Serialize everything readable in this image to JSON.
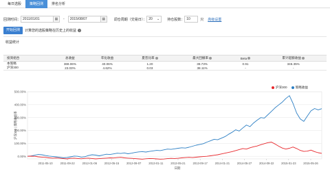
{
  "tabs": [
    "每日选股",
    "策略回测",
    "排名分析"
  ],
  "active_tab": 1,
  "toolbar": {
    "period_label": "回测时间：",
    "start_date": "2011/01/01",
    "date_separator": "-",
    "end_date": "2015/08/07",
    "cycle_label": "调仓周期（交易日）：",
    "cycle_value": "20",
    "hold_label": "持仓股数：",
    "hold_value": "10",
    "hold_unit": "只",
    "advanced_link": "高级设置"
  },
  "run": {
    "button": "开始回测",
    "hint": "计算您的选股策略在历史上的收益"
  },
  "section_title": "收益统计",
  "stats_table": {
    "headers": [
      "投资组合",
      "总收益",
      "年化收益",
      "夏普比率",
      "最大回撤率",
      "Beta",
      "累计超额收益"
    ],
    "rows": [
      [
        "本策略",
        "369.06%",
        "40.06%",
        "1.20",
        "38.73%",
        "0.91",
        "346.35%"
      ],
      [
        "沪深300",
        "23.03%",
        "4.62%",
        "0.03",
        "38.11%",
        "-",
        "-"
      ]
    ]
  },
  "legend": [
    {
      "name": "沪深300",
      "color": "#e8272c"
    },
    {
      "name": "策略收益",
      "color": "#2c7fc4"
    }
  ],
  "chart_data": {
    "type": "line",
    "ylabel": "沪深300 | 策略收益率",
    "xlabel": "日期",
    "y_ticks": [
      "500.00%",
      "400.00%",
      "300.00%",
      "200.00%",
      "100.00%",
      "0.00%"
    ],
    "ylim": [
      -20,
      500
    ],
    "x_ticks": [
      "2011-05-10",
      "2011-09-22",
      "2012-01-06",
      "2012-05-15",
      "2012-09-07",
      "2013-01-11",
      "2013-05-21",
      "2013-09-17",
      "2014-01-21",
      "2014-05-27",
      "2014-09-22",
      "2015-01-23",
      "2015-05-26"
    ],
    "series": [
      {
        "name": "策略收益",
        "color": "#2c7fc4",
        "values": [
          0,
          3,
          8,
          14,
          12,
          6,
          2,
          -1,
          -4,
          -8,
          -12,
          -10,
          -4,
          2,
          0,
          -6,
          -3,
          6,
          12,
          9,
          4,
          10,
          16,
          14,
          19,
          24,
          22,
          26,
          20,
          24,
          30,
          34,
          36,
          33,
          38,
          42,
          46,
          44,
          50,
          56,
          54,
          58,
          62,
          66,
          64,
          70,
          78,
          86,
          92,
          98,
          110,
          120,
          132,
          128,
          140,
          152,
          170,
          186,
          205,
          196,
          220,
          242,
          230,
          258,
          280,
          300,
          296,
          322,
          348,
          376,
          398,
          420,
          448,
          470,
          410,
          335,
          290,
          270,
          312,
          352,
          370,
          360,
          369
        ]
      },
      {
        "name": "沪深300",
        "color": "#e8272c",
        "values": [
          0,
          1,
          0,
          -4,
          -6,
          -8,
          -12,
          -14,
          -13,
          -15,
          -18,
          -20,
          -16,
          -14,
          -17,
          -19,
          -16,
          -14,
          -17,
          -20,
          -18,
          -16,
          -14,
          -12,
          -13,
          -10,
          -8,
          -12,
          -14,
          -16,
          -18,
          -20,
          -22,
          -19,
          -17,
          -18,
          -20,
          -22,
          -21,
          -18,
          -16,
          -17,
          -15,
          -12,
          -10,
          -8,
          -10,
          -7,
          -4,
          -2,
          0,
          4,
          8,
          12,
          18,
          24,
          30,
          36,
          44,
          52,
          60,
          56,
          66,
          74,
          80,
          90,
          98,
          106,
          110,
          95,
          78,
          64,
          56,
          62,
          72,
          60,
          46,
          38,
          40,
          48,
          36,
          28,
          23
        ]
      }
    ]
  }
}
